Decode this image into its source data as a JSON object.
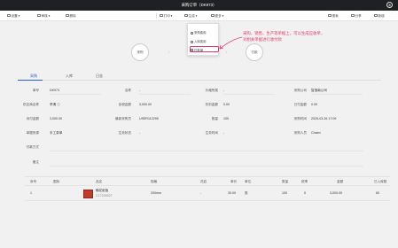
{
  "window": {
    "title": "采购订单（DK973）",
    "close_glyph": "⊗"
  },
  "toolbar": {
    "settings": "设置",
    "approve": "审核",
    "delete": "删除",
    "print": "打印",
    "generate": "生成",
    "more": "更多",
    "search": "搜索",
    "share": "分享",
    "new": "新增"
  },
  "dropdown": {
    "items": [
      "采购费用",
      "入库费用",
      "付款单"
    ],
    "selected_index": 2
  },
  "annotation": {
    "line1": "采购、销售、生产等单据上，可以生成应收单，",
    "line2": "对相关单据进行收付款"
  },
  "flow": {
    "left": "采购",
    "right": "付款"
  },
  "tabs": {
    "items": [
      "采购",
      "入库",
      "日志"
    ],
    "active": 0
  },
  "form": {
    "fields": {
      "no_label": "单号",
      "no_value": "DK973",
      "name_label": "名称",
      "name_value": "-",
      "period_label": "价格所属",
      "period_value": "-",
      "company_label": "采购公司",
      "company_value": "智造南公司",
      "supplier_label": "供应商名称",
      "supplier_value": "李清",
      "amount_label": "含税金额",
      "amount_value": "3,000.00",
      "discount_label": "折扣金额",
      "discount_value": "0.00",
      "paid_label": "已付金额",
      "paid_value": "0.00",
      "unpaid_label": "待付金额",
      "unpaid_value": "3,000.00",
      "account_label": "最新采购员",
      "account_value": "USER112295",
      "qty_label": "数量",
      "qty_value": "100",
      "time_label": "采购时间",
      "time_value": "2025-03-26 17:09",
      "source_label": "单据来源",
      "source_value": "手工录单",
      "status_label": "生效状态",
      "status_value": "-",
      "check_label": "生效时间",
      "check_value": "-",
      "buyer_label": "采购人员",
      "buyer_value": "Chaen",
      "addr_label": "付款方式",
      "addr_value": "",
      "remark_label": "备注",
      "remark_value": ""
    }
  },
  "table": {
    "headers": [
      "序号",
      "图标",
      "品名",
      "规格",
      "花纹",
      "单价",
      "单位",
      "数量",
      "税率",
      "金额",
      "已入库数"
    ],
    "rows": [
      {
        "index": "1",
        "name": "输花纸板",
        "code": "C17226927",
        "spec": "200mm",
        "pattern": "-",
        "price": "30.00",
        "unit": "张",
        "qty": "100",
        "tax": "0",
        "amount": "3,000.00",
        "received": "60"
      }
    ]
  },
  "colors": {
    "accent": "#2a5bd7",
    "annotation": "#e03c6e",
    "titlebar": "#1f2023"
  }
}
